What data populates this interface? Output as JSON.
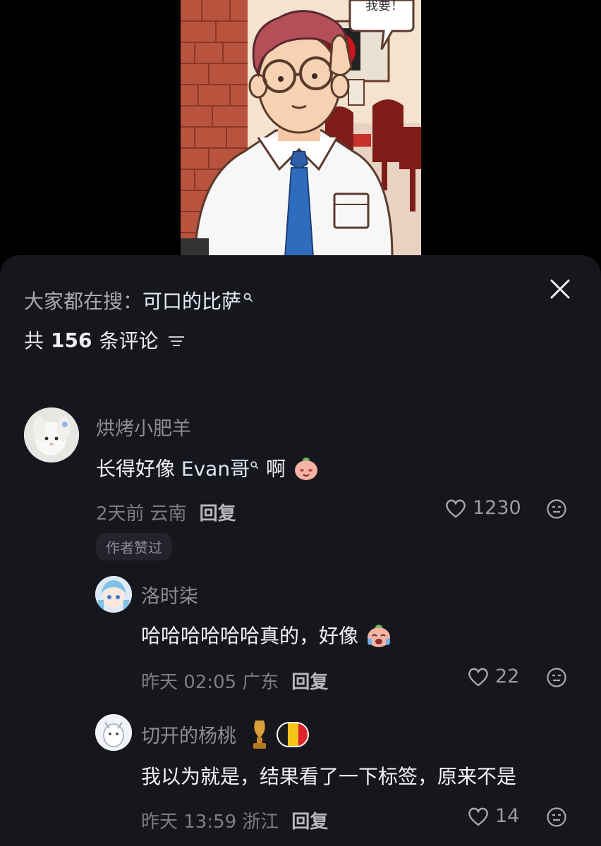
{
  "search": {
    "prefix": "大家都在搜：",
    "keyword": "可口的比萨"
  },
  "header": {
    "count_prefix": "共",
    "count": "156",
    "count_suffix": "条评论"
  },
  "comments": [
    {
      "username": "烘烤小肥羊",
      "text_before": "长得好像 ",
      "text_link": "Evan哥",
      "text_after": " 啊",
      "time": "2天前",
      "location": "云南",
      "reply_label": "回复",
      "likes": "1230",
      "badge": "作者赞过"
    },
    {
      "username": "洛时柒",
      "text": "哈哈哈哈哈哈真的，好像",
      "time": "昨天 02:05",
      "location": "广东",
      "reply_label": "回复",
      "likes": "22"
    },
    {
      "username": "切开的杨桃",
      "text": "我以为就是，结果看了一下标签，原来不是",
      "time": "昨天 13:59",
      "location": "浙江",
      "reply_label": "回复",
      "likes": "14"
    }
  ],
  "video": {
    "speech_bubble_text": "我要！"
  },
  "colors": {
    "sheet_bg": "#16161d",
    "primary_text": "#f2f2f5",
    "secondary_text": "#8e8e97"
  }
}
